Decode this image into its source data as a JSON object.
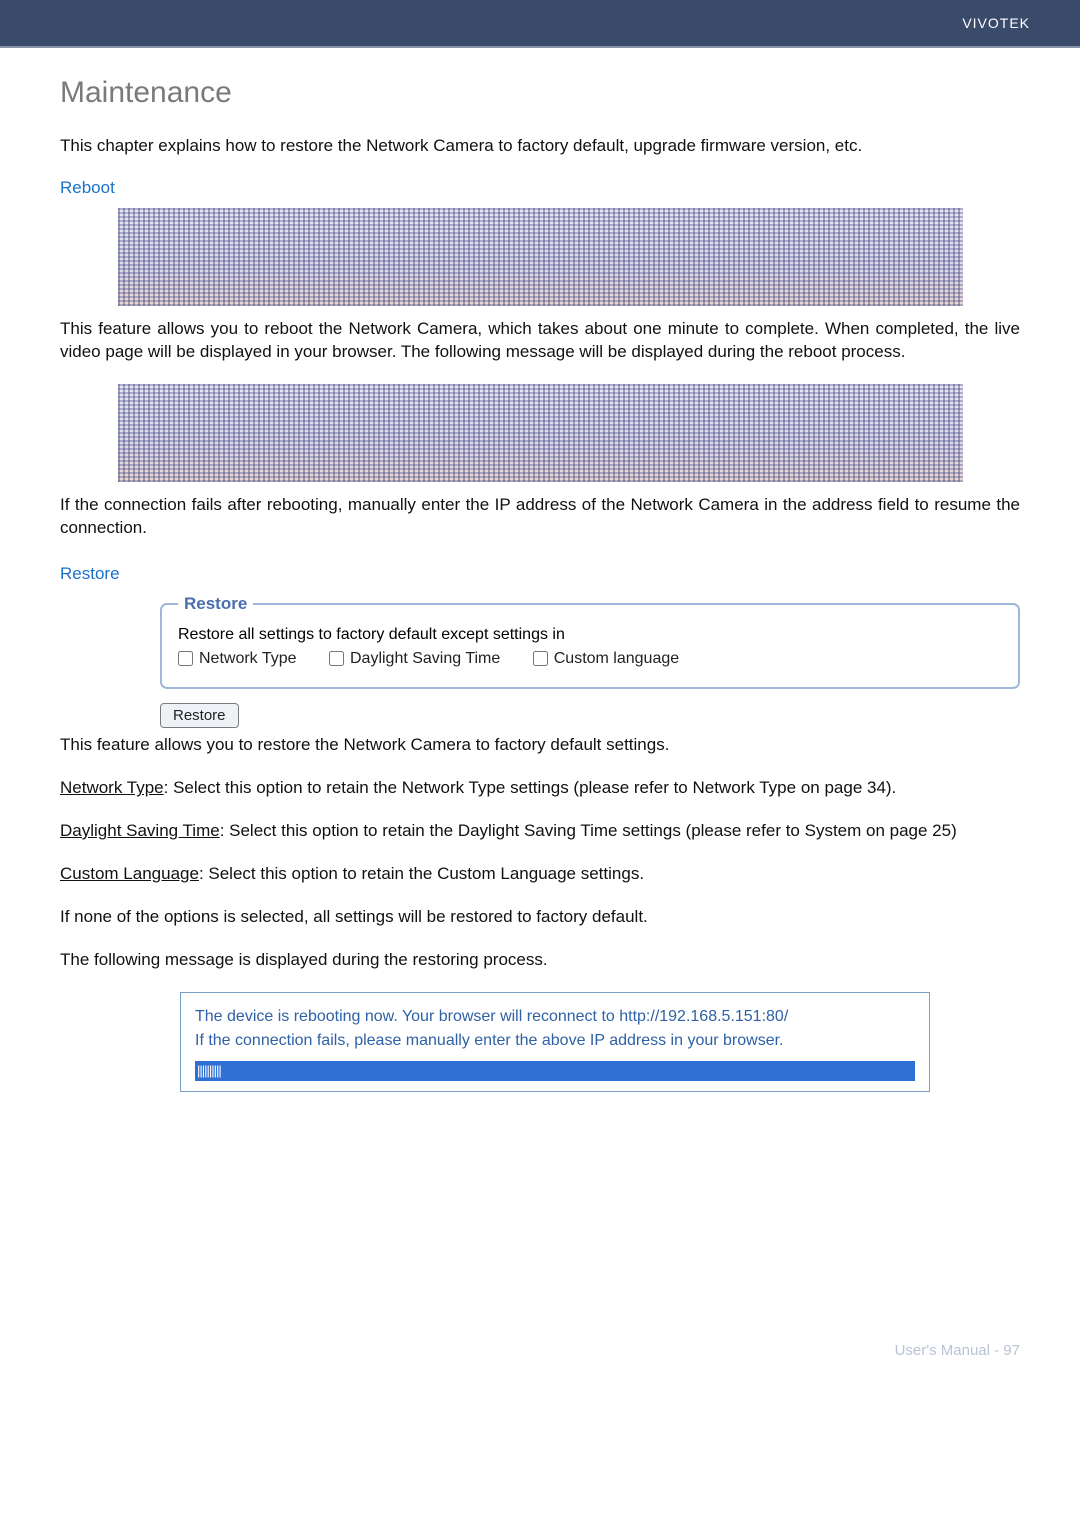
{
  "header": {
    "brand": "VIVOTEK"
  },
  "title": "Maintenance",
  "intro": "This chapter explains how to restore the Network Camera to factory default, upgrade firmware version, etc.",
  "reboot": {
    "heading": "Reboot",
    "p1": "This feature allows you to reboot the Network Camera, which takes about one minute to complete. When completed, the live video page will be displayed in your browser. The following message will be displayed during the reboot process.",
    "p2": "If the connection fails after rebooting, manually enter the IP address of the Network Camera in the address field to resume the connection."
  },
  "restore": {
    "heading": "Restore",
    "legend": "Restore",
    "fieldset_text": "Restore all settings to factory default except settings in",
    "checkboxes": {
      "network": "Network Type",
      "dst": "Daylight Saving Time",
      "lang": "Custom language"
    },
    "button": "Restore",
    "p1": "This feature allows you to restore the Network Camera to factory default settings.",
    "net_label": "Network Type",
    "net_text": ": Select this option to retain the Network Type settings (please refer to Network Type on page 34).",
    "dst_label": "Daylight Saving Time",
    "dst_text": ": Select this option to retain the Daylight Saving Time settings (please refer to System on page 25)",
    "lang_label": "Custom Language",
    "lang_text": ": Select this option to retain the Custom Language settings.",
    "p_none": "If none of the options is selected, all settings will be restored to factory default.",
    "p_msg": "The following message is displayed during the restoring process."
  },
  "message": {
    "line1": "The device is rebooting now. Your browser will reconnect to http://192.168.5.151:80/",
    "line2": "If the connection fails, please manually enter the above IP address in your browser.",
    "ticks": "||||||||||"
  },
  "footer": "User's Manual - 97"
}
